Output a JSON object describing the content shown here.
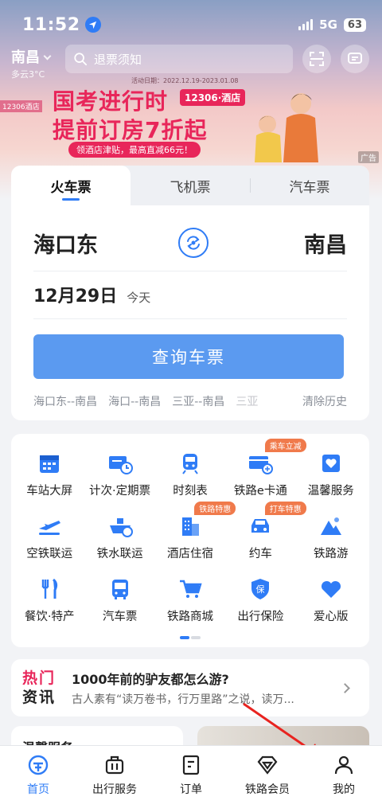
{
  "status_bar": {
    "time": "11:52",
    "network": "5G",
    "battery": "63"
  },
  "header": {
    "city": "南昌",
    "weather": "多云3°C",
    "search_placeholder": "退票须知"
  },
  "banner": {
    "date_range": "活动日期：2022.12.19-2023.01.08",
    "line1": "国考进行时",
    "tag": "12306·酒店",
    "line2": "提前订房7折起",
    "pill": "领酒店津贴，最高直减66元！",
    "store_label": "12306酒店",
    "ad_label": "广告"
  },
  "ticket_tabs": [
    {
      "label": "火车票",
      "active": true
    },
    {
      "label": "飞机票",
      "active": false
    },
    {
      "label": "汽车票",
      "active": false
    }
  ],
  "route": {
    "from": "海口东",
    "to": "南昌"
  },
  "date": {
    "value": "12月29日",
    "note": "今天"
  },
  "query_button": "查询车票",
  "history": [
    "海口东--南昌",
    "海口--南昌",
    "三亚--南昌",
    "三亚"
  ],
  "clear_history": "清除历史",
  "services": [
    {
      "label": "车站大屏",
      "icon": "calendar-icon",
      "badge": ""
    },
    {
      "label": "计次·定期票",
      "icon": "ticket-clock-icon",
      "badge": ""
    },
    {
      "label": "时刻表",
      "icon": "train-icon",
      "badge": ""
    },
    {
      "label": "铁路e卡通",
      "icon": "card-icon",
      "badge": "乘车立减"
    },
    {
      "label": "温馨服务",
      "icon": "heart-box-icon",
      "badge": ""
    },
    {
      "label": "空铁联运",
      "icon": "plane-icon",
      "badge": ""
    },
    {
      "label": "铁水联运",
      "icon": "ship-icon",
      "badge": ""
    },
    {
      "label": "酒店住宿",
      "icon": "hotel-icon",
      "badge": "铁路特惠"
    },
    {
      "label": "约车",
      "icon": "car-icon",
      "badge": "打车特惠"
    },
    {
      "label": "铁路游",
      "icon": "mountain-icon",
      "badge": ""
    },
    {
      "label": "餐饮·特产",
      "icon": "utensils-icon",
      "badge": ""
    },
    {
      "label": "汽车票",
      "icon": "bus-icon",
      "badge": ""
    },
    {
      "label": "铁路商城",
      "icon": "cart-icon",
      "badge": ""
    },
    {
      "label": "出行保险",
      "icon": "shield-icon",
      "badge": ""
    },
    {
      "label": "爱心版",
      "icon": "heart-icon",
      "badge": ""
    }
  ],
  "news": {
    "logo_line1": "热门",
    "logo_line2": "资讯",
    "title": "1000年前的驴友都怎么游?",
    "subtitle": "古人素有“读万卷书，行万里路”之说，读万..."
  },
  "peek_title": "温馨服务",
  "tabbar": [
    {
      "label": "首页",
      "active": true
    },
    {
      "label": "出行服务",
      "active": false
    },
    {
      "label": "订单",
      "active": false
    },
    {
      "label": "铁路会员",
      "active": false
    },
    {
      "label": "我的",
      "active": false
    }
  ],
  "colors": {
    "accent": "#2f7cf6",
    "query_button": "#5b9af0",
    "banner_red": "#e8265a",
    "badge": "#f07a4b"
  }
}
